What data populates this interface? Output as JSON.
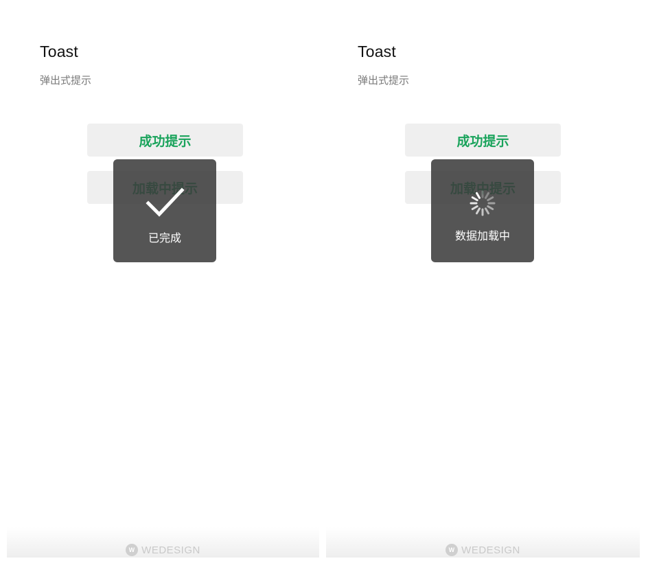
{
  "screens": [
    {
      "title": "Toast",
      "subtitle": "弹出式提示",
      "buttons": [
        {
          "label": "成功提示"
        },
        {
          "label": "加载中提示"
        }
      ],
      "toast": {
        "type": "success",
        "icon": "checkmark-icon",
        "message": "已完成"
      },
      "footer": {
        "brand": "WEDESIGN",
        "logo_text": "W"
      }
    },
    {
      "title": "Toast",
      "subtitle": "弹出式提示",
      "buttons": [
        {
          "label": "成功提示"
        },
        {
          "label": "加载中提示"
        }
      ],
      "toast": {
        "type": "loading",
        "icon": "spinner-icon",
        "message": "数据加载中"
      },
      "footer": {
        "brand": "WEDESIGN",
        "logo_text": "W"
      }
    }
  ],
  "colors": {
    "accent_green": "#19a35b",
    "toast_bg": "#3c3c3c",
    "button_bg": "#efefef"
  }
}
